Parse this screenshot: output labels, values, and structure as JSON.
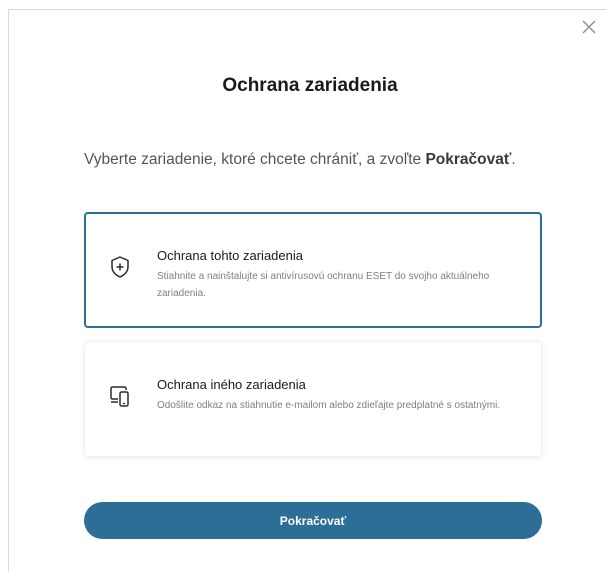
{
  "dialog": {
    "title": "Ochrana zariadenia",
    "close_icon": "close-icon",
    "instruction_text": "Vyberte zariadenie, ktoré chcete chrániť, a zvoľte ",
    "instruction_bold": "Pokračovať",
    "instruction_end": "."
  },
  "options": [
    {
      "title": "Ochrana tohto zariadenia",
      "description": "Stiahnite a nainštalujte si antivírusovú ochranu ESET do svojho aktuálneho zariadenia.",
      "icon": "shield-plus-icon",
      "selected": true
    },
    {
      "title": "Ochrana iného zariadenia",
      "description": "Odošlite odkaz na stiahnutie e-mailom alebo zdieľajte predplatné s ostatnými.",
      "icon": "devices-icon",
      "selected": false
    }
  ],
  "continue_button": {
    "label": "Pokračovať"
  },
  "colors": {
    "accent": "#2c6e96",
    "title_text": "#1a1a1a",
    "muted_text": "#808080",
    "border": "#d9d9d9"
  }
}
